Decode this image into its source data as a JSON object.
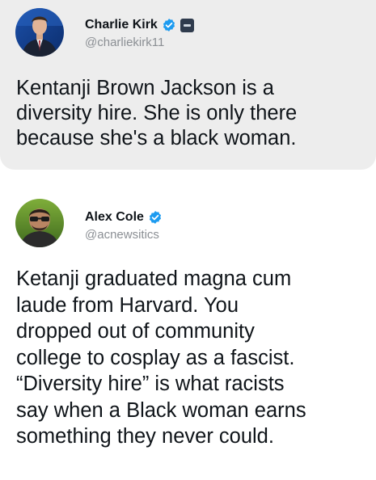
{
  "tweets": [
    {
      "author_name": "Charlie Kirk",
      "handle": "@charliekirk11",
      "verified_badge": "verified-check-icon",
      "affiliation_badge": "affiliate-org-icon",
      "text_lines": [
        "Kentanji Brown Jackson is a",
        "diversity hire. She is only there",
        "because she's a black woman."
      ],
      "background": "#ededed"
    },
    {
      "author_name": "Alex Cole",
      "handle": "@acnewsitics",
      "verified_badge": "verified-check-icon",
      "text_lines": [
        "Ketanji graduated magna cum",
        "laude from Harvard. You",
        "dropped out of community",
        "college to cosplay as a fascist.",
        "“Diversity hire” is what racists",
        "say when a Black woman earns",
        "something they never could."
      ],
      "background": "#ffffff"
    }
  ],
  "colors": {
    "verified_blue": "#1d9bf0",
    "handle_gray": "#8b8f94",
    "text": "#0f1419"
  }
}
